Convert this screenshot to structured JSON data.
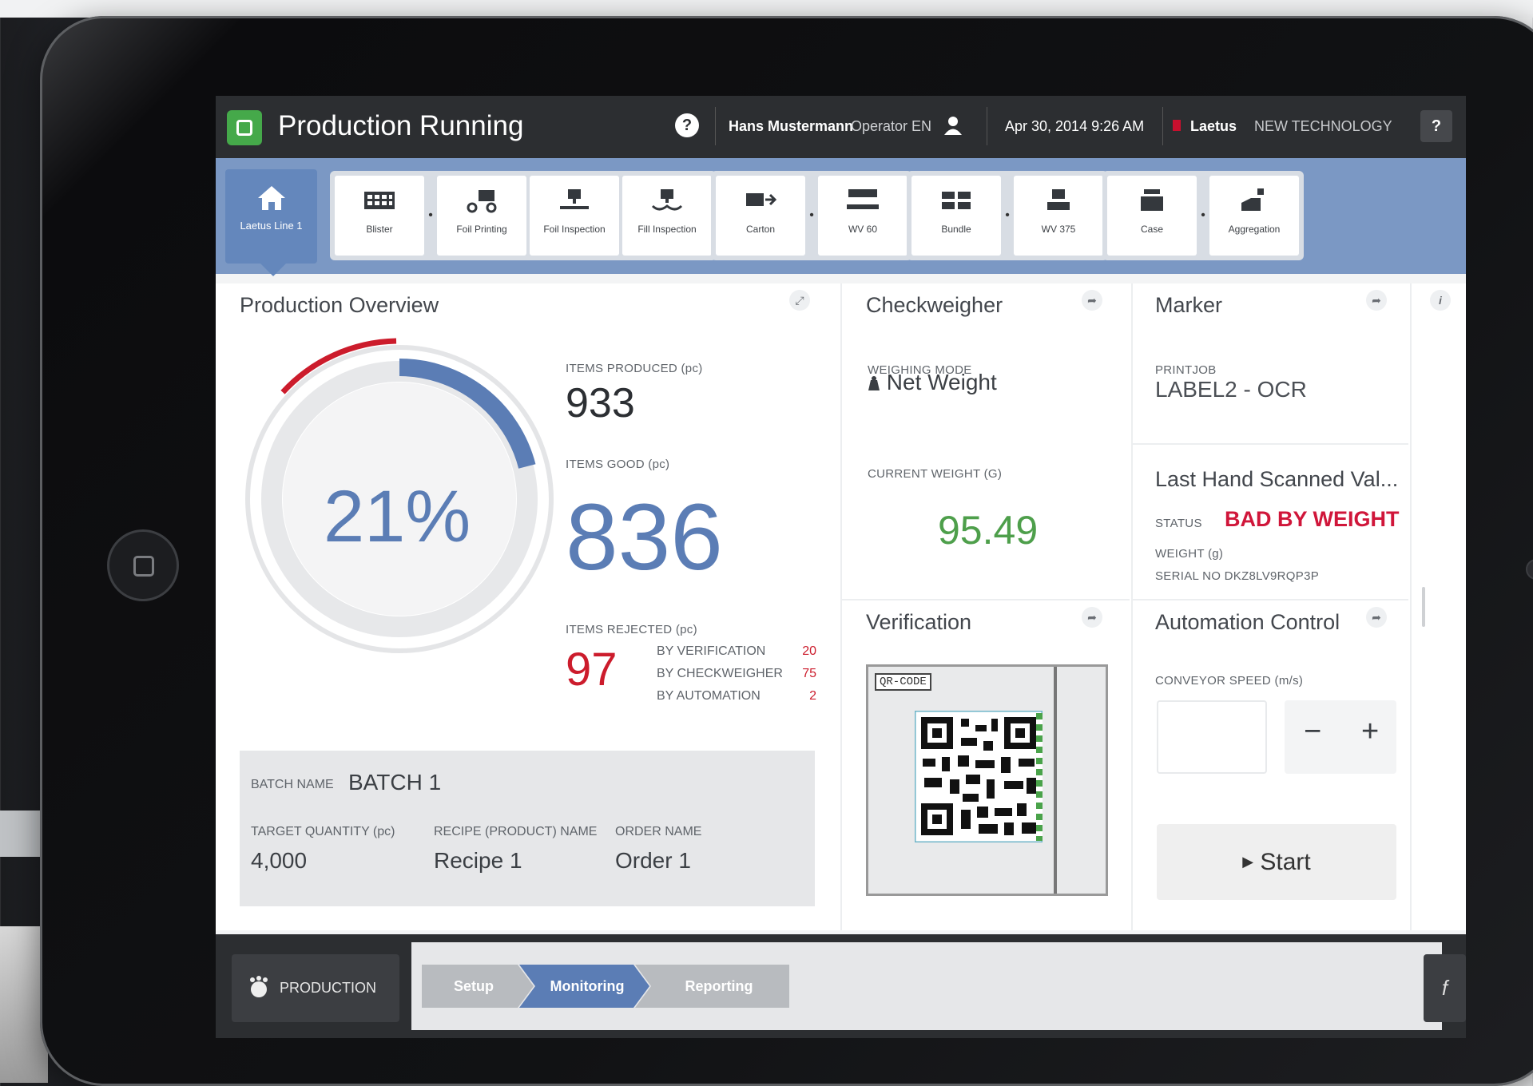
{
  "topbar": {
    "title": "Production Running",
    "user_name": "Hans Mustermann",
    "user_role": "Operator EN",
    "datetime": "Apr 30, 2014 9:26 AM",
    "brand": "Laetus",
    "brand_sub": "NEW TECHNOLOGY",
    "help_label": "?"
  },
  "nav": {
    "home_label": "Laetus Line 1",
    "stations": [
      {
        "label": "Blister"
      },
      {
        "label": "Foil Printing"
      },
      {
        "label": "Foil Inspection"
      },
      {
        "label": "Fill Inspection"
      },
      {
        "label": "Carton"
      },
      {
        "label": "WV 60"
      },
      {
        "label": "Bundle"
      },
      {
        "label": "WV 375"
      },
      {
        "label": "Case"
      },
      {
        "label": "Aggregation"
      }
    ]
  },
  "overview": {
    "title": "Production Overview",
    "percent": "21%",
    "progress_fraction": 0.21,
    "items_produced_label": "ITEMS PRODUCED (pc)",
    "items_produced": "933",
    "items_good_label": "ITEMS GOOD (pc)",
    "items_good": "836",
    "items_rejected_label": "ITEMS REJECTED (pc)",
    "items_rejected": "97",
    "rejects": [
      {
        "label": "BY VERIFICATION",
        "value": "20"
      },
      {
        "label": "BY CHECKWEIGHER",
        "value": "75"
      },
      {
        "label": "BY AUTOMATION",
        "value": "2"
      }
    ],
    "batch_name_label": "BATCH NAME",
    "batch_name": "BATCH 1",
    "target_qty_label": "TARGET QUANTITY (pc)",
    "target_qty": "4,000",
    "recipe_label": "RECIPE (PRODUCT) NAME",
    "recipe": "Recipe 1",
    "order_label": "ORDER NAME",
    "order": "Order 1"
  },
  "checkweigher": {
    "title": "Checkweigher",
    "mode_label": "WEIGHING MODE",
    "mode": "Net Weight",
    "weight_label": "CURRENT WEIGHT (G)",
    "weight": "95.49"
  },
  "marker": {
    "title": "Marker",
    "printjob_label": "PRINTJOB",
    "printjob": "LABEL2 - OCR"
  },
  "scan": {
    "title": "Last Hand Scanned Val...",
    "status_label": "STATUS",
    "status": "BAD BY WEIGHT",
    "weight_label": "WEIGHT (g)",
    "serial_label": "SERIAL NO",
    "serial": "DKZ8LV9RQP3P"
  },
  "verification": {
    "title": "Verification",
    "code_label": "QR-CODE"
  },
  "automation": {
    "title": "Automation Control",
    "speed_label": "CONVEYOR SPEED (m/s)",
    "minus": "−",
    "plus": "+",
    "start_label": "Start"
  },
  "bottom": {
    "production_label": "PRODUCTION",
    "steps": [
      "Setup",
      "Monitoring",
      "Reporting"
    ]
  },
  "colors": {
    "accent_blue": "#5b7db5",
    "reject_red": "#cc1c2c",
    "good_green": "#4e9f4b",
    "nav_blue": "#7b98c4"
  }
}
